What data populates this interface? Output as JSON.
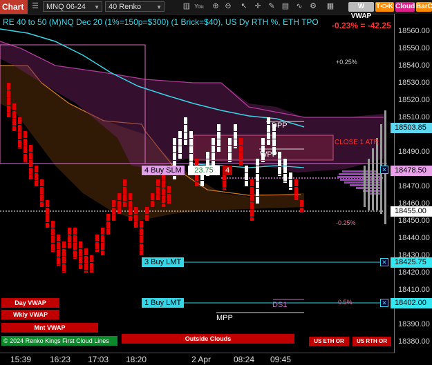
{
  "toolbar": {
    "chart_tab": "Chart",
    "instrument": "MNQ 06-24",
    "bar_type": "40 Renko",
    "vwap_label": "W VWAP",
    "tk_label": "T<>K",
    "cloud_label": "Cloud",
    "barc_label": "BarC",
    "you_label": "You"
  },
  "title": "RE 40 to 50 (M)NQ Dec 20 (1%=150p=$300) (1 Brick=$40), US Dy RTH %, ETH TPO",
  "change": "-0.23% = -42.25",
  "price_axis": {
    "ticks": [
      "18560.00",
      "18550.00",
      "18540.00",
      "18530.00",
      "18520.00",
      "18510.00",
      "18490.00",
      "18470.00",
      "18460.00",
      "18450.00",
      "18440.00",
      "18430.00",
      "18420.00",
      "18410.00",
      "18390.00",
      "18380.00"
    ],
    "tags": [
      {
        "label": "18503.85",
        "bg": "#5cd8f0",
        "fg": "#000"
      },
      {
        "label": "18478.50",
        "bg": "#e8a0e8",
        "fg": "#000"
      },
      {
        "label": "18455.00",
        "bg": "#ffffff",
        "fg": "#000"
      },
      {
        "label": "18425.75",
        "bg": "#33e6f0",
        "fg": "#000"
      },
      {
        "label": "18402.00",
        "bg": "#33e6f0",
        "fg": "#000"
      }
    ]
  },
  "time_axis": [
    "15:39",
    "16:23",
    "17:03",
    "18:20",
    "2 Apr",
    "08:24",
    "09:45"
  ],
  "orders": {
    "buy_slm": {
      "label": "4 Buy SLM",
      "price": "23.75",
      "qty": "4"
    },
    "buy_lmt3": "3 Buy LMT",
    "buy_lmt1": "1 Buy LMT"
  },
  "chart_labels": {
    "dpp": "DPP",
    "wpp": "WPP",
    "ds1": "DS1",
    "mpp": "MPP",
    "close_1atr": "CLOSE 1 ATR",
    "pct_plus025": "+0.25%",
    "pct_minus025": "-0.25%",
    "pct_05": "0.5%"
  },
  "bottom_buttons": {
    "day_vwap": "Day VWAP",
    "wkly_vwap": "Wkly VWAP",
    "mnt_vwap": "Mnt VWAP",
    "copyright": "© 2024 Renko Kings First Cloud Lines",
    "outside_clouds": "Outside Clouds",
    "us_eth_or": "US ETH OR",
    "us_rth_or": "US RTH OR"
  },
  "colors": {
    "bull_brick": "#ffffff",
    "bear_brick": "#e00000",
    "vwap_line": "#35d6e8",
    "cloud_orange": "#c07020",
    "cloud_purple": "#7a2a6a"
  }
}
